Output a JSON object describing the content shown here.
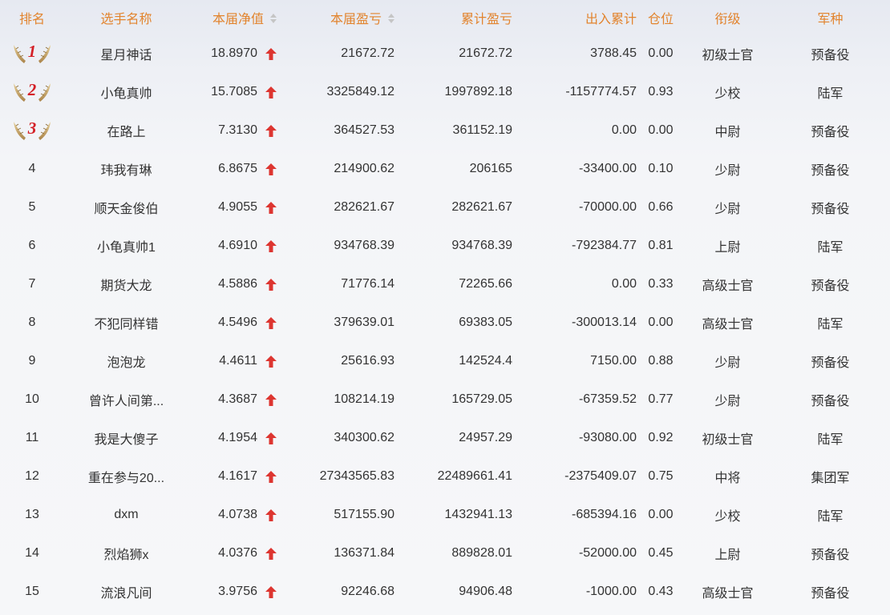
{
  "headers": {
    "rank": "排名",
    "name": "选手名称",
    "nav": "本届净值",
    "pnl": "本届盈亏",
    "cum_pnl": "累计盈亏",
    "flow": "出入累计",
    "position": "仓位",
    "title": "衔级",
    "branch": "军种"
  },
  "icons": {
    "medal": "laurel-wings-medal-icon",
    "trend": "red-up-arrow-icon",
    "sort": "sort-arrows-icon"
  },
  "colors": {
    "header_text": "#e2842e",
    "rank_number": "#d42027",
    "arrow": "#dd3530",
    "medal_gold": "#c9a667"
  },
  "rows": [
    {
      "rank": "1",
      "name": "星月神话",
      "nav": "18.8970",
      "pnl": "21672.72",
      "cum_pnl": "21672.72",
      "flow": "3788.45",
      "position": "0.00",
      "title": "初级士官",
      "branch": "预备役"
    },
    {
      "rank": "2",
      "name": "小龟真帅",
      "nav": "15.7085",
      "pnl": "3325849.12",
      "cum_pnl": "1997892.18",
      "flow": "-1157774.57",
      "position": "0.93",
      "title": "少校",
      "branch": "陆军"
    },
    {
      "rank": "3",
      "name": "在路上",
      "nav": "7.3130",
      "pnl": "364527.53",
      "cum_pnl": "361152.19",
      "flow": "0.00",
      "position": "0.00",
      "title": "中尉",
      "branch": "预备役"
    },
    {
      "rank": "4",
      "name": "玮我有琳",
      "nav": "6.8675",
      "pnl": "214900.62",
      "cum_pnl": "206165",
      "flow": "-33400.00",
      "position": "0.10",
      "title": "少尉",
      "branch": "预备役"
    },
    {
      "rank": "5",
      "name": "顺天金俊伯",
      "nav": "4.9055",
      "pnl": "282621.67",
      "cum_pnl": "282621.67",
      "flow": "-70000.00",
      "position": "0.66",
      "title": "少尉",
      "branch": "预备役"
    },
    {
      "rank": "6",
      "name": "小龟真帅1",
      "nav": "4.6910",
      "pnl": "934768.39",
      "cum_pnl": "934768.39",
      "flow": "-792384.77",
      "position": "0.81",
      "title": "上尉",
      "branch": "陆军"
    },
    {
      "rank": "7",
      "name": "期货大龙",
      "nav": "4.5886",
      "pnl": "71776.14",
      "cum_pnl": "72265.66",
      "flow": "0.00",
      "position": "0.33",
      "title": "高级士官",
      "branch": "预备役"
    },
    {
      "rank": "8",
      "name": "不犯同样错",
      "nav": "4.5496",
      "pnl": "379639.01",
      "cum_pnl": "69383.05",
      "flow": "-300013.14",
      "position": "0.00",
      "title": "高级士官",
      "branch": "陆军"
    },
    {
      "rank": "9",
      "name": "泡泡龙",
      "nav": "4.4611",
      "pnl": "25616.93",
      "cum_pnl": "142524.4",
      "flow": "7150.00",
      "position": "0.88",
      "title": "少尉",
      "branch": "预备役"
    },
    {
      "rank": "10",
      "name": "曾许人间第...",
      "nav": "4.3687",
      "pnl": "108214.19",
      "cum_pnl": "165729.05",
      "flow": "-67359.52",
      "position": "0.77",
      "title": "少尉",
      "branch": "预备役"
    },
    {
      "rank": "11",
      "name": "我是大傻子",
      "nav": "4.1954",
      "pnl": "340300.62",
      "cum_pnl": "24957.29",
      "flow": "-93080.00",
      "position": "0.92",
      "title": "初级士官",
      "branch": "陆军"
    },
    {
      "rank": "12",
      "name": "重在参与20...",
      "nav": "4.1617",
      "pnl": "27343565.83",
      "cum_pnl": "22489661.41",
      "flow": "-2375409.07",
      "position": "0.75",
      "title": "中将",
      "branch": "集团军"
    },
    {
      "rank": "13",
      "name": "dxm",
      "nav": "4.0738",
      "pnl": "517155.90",
      "cum_pnl": "1432941.13",
      "flow": "-685394.16",
      "position": "0.00",
      "title": "少校",
      "branch": "陆军"
    },
    {
      "rank": "14",
      "name": "烈焰狮x",
      "nav": "4.0376",
      "pnl": "136371.84",
      "cum_pnl": "889828.01",
      "flow": "-52000.00",
      "position": "0.45",
      "title": "上尉",
      "branch": "预备役"
    },
    {
      "rank": "15",
      "name": "流浪凡间",
      "nav": "3.9756",
      "pnl": "92246.68",
      "cum_pnl": "94906.48",
      "flow": "-1000.00",
      "position": "0.43",
      "title": "高级士官",
      "branch": "预备役"
    }
  ]
}
